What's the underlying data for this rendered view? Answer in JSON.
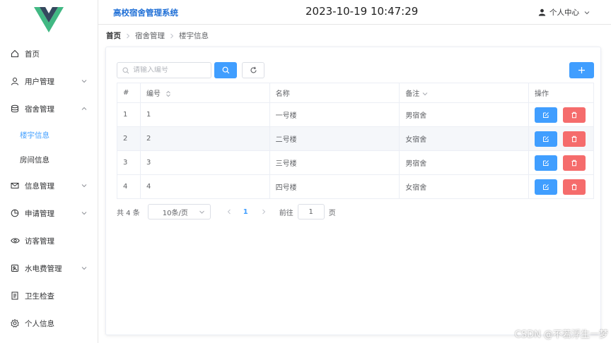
{
  "app": {
    "title": "高校宿舍管理系统",
    "clock": "2023-10-19 10:47:29"
  },
  "header": {
    "user_center": "个人中心"
  },
  "sidebar": {
    "items": [
      {
        "label": "首页",
        "icon": "home-icon"
      },
      {
        "label": "用户管理",
        "icon": "user-icon"
      },
      {
        "label": "宿舍管理",
        "icon": "database-icon"
      },
      {
        "label": "信息管理",
        "icon": "mail-icon"
      },
      {
        "label": "申请管理",
        "icon": "pie-chart-icon"
      },
      {
        "label": "访客管理",
        "icon": "eye-icon"
      },
      {
        "label": "水电费管理",
        "icon": "meter-icon"
      },
      {
        "label": "卫生检查",
        "icon": "checklist-icon"
      },
      {
        "label": "个人信息",
        "icon": "gear-icon"
      }
    ],
    "sub_items": [
      {
        "label": "楼宇信息",
        "active": true
      },
      {
        "label": "房间信息",
        "active": false
      }
    ]
  },
  "breadcrumb": [
    "首页",
    "宿舍管理",
    "楼宇信息"
  ],
  "toolbar": {
    "search_placeholder": "请输入编号",
    "search_value": ""
  },
  "table": {
    "headers": {
      "idx": "#",
      "code": "编号",
      "name": "名称",
      "note": "备注",
      "op": "操作"
    },
    "rows": [
      {
        "idx": "1",
        "code": "1",
        "name": "一号楼",
        "note": "男宿舍"
      },
      {
        "idx": "2",
        "code": "2",
        "name": "二号楼",
        "note": "女宿舍"
      },
      {
        "idx": "3",
        "code": "3",
        "name": "三号楼",
        "note": "男宿舍"
      },
      {
        "idx": "4",
        "code": "4",
        "name": "四号楼",
        "note": "女宿舍"
      }
    ]
  },
  "pagination": {
    "total": "共 4 条",
    "page_size": "10条/页",
    "current_page": "1",
    "goto_label": "前往",
    "goto_value": "1",
    "page_label": "页"
  },
  "watermark": "CSDN @不若浮生一梦",
  "colors": {
    "primary": "#409eff",
    "danger": "#f56c6c",
    "logo_green": "#41b883",
    "logo_dark": "#34495e"
  }
}
